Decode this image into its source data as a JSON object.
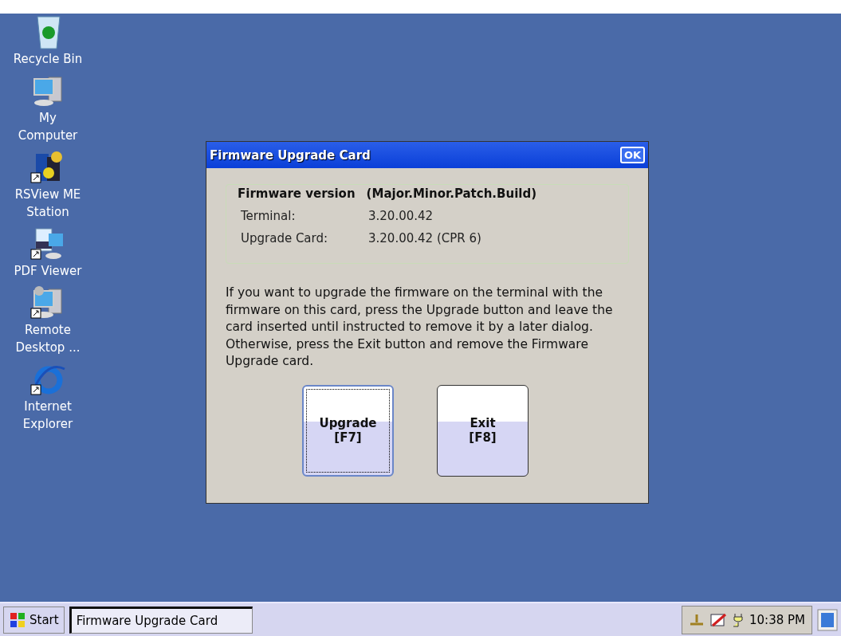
{
  "desktop_icons": [
    {
      "kind": "recycle",
      "label": "Recycle Bin",
      "shortcut": false
    },
    {
      "kind": "computer",
      "label": "My Computer",
      "shortcut": false
    },
    {
      "kind": "app",
      "label": "RSView ME Station",
      "shortcut": true
    },
    {
      "kind": "pdf",
      "label": "PDF Viewer",
      "shortcut": true
    },
    {
      "kind": "remote",
      "label": "Remote Desktop ...",
      "shortcut": true
    },
    {
      "kind": "browser",
      "label": "Internet Explorer",
      "shortcut": true
    }
  ],
  "dialog": {
    "title": "Firmware Upgrade Card",
    "ok_button": "OK",
    "group": {
      "heading": "Firmware version",
      "format": "(Major.Minor.Patch.Build)",
      "rows": [
        {
          "label": "Terminal:",
          "value": "3.20.00.42"
        },
        {
          "label": "Upgrade Card:",
          "value": "3.20.00.42 (CPR 6)"
        }
      ]
    },
    "message": "If you want to upgrade the firmware on the terminal with the firmware on this card, press the Upgrade button and leave the card inserted until instructed to remove it by a later dialog. Otherwise, press the Exit button and remove the Firmware Upgrade card.",
    "buttons": [
      {
        "label": "Upgrade",
        "key": "[F7]",
        "focused": true
      },
      {
        "label": "Exit",
        "key": "[F8]",
        "focused": false
      }
    ]
  },
  "taskbar": {
    "start": "Start",
    "tasks": [
      {
        "label": "Firmware Upgrade Card",
        "selected": true
      }
    ],
    "clock": "10:38 PM"
  }
}
